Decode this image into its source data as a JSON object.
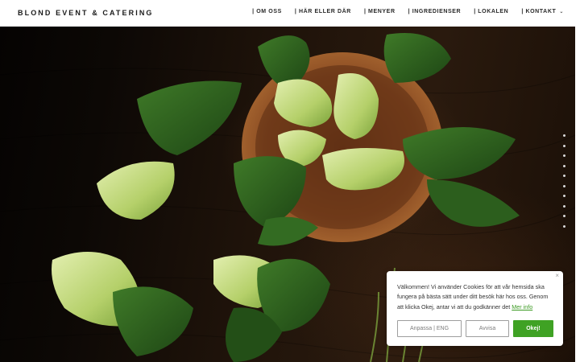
{
  "header": {
    "brand": "BLOND EVENT & CATERING",
    "nav": [
      {
        "label": "| OM OSS"
      },
      {
        "label": "| HÄR ELLER DÄR"
      },
      {
        "label": "| MENYER"
      },
      {
        "label": "| INGREDIENSER"
      },
      {
        "label": "| LOKALEN"
      },
      {
        "label": "| KONTAKT",
        "has_dropdown": true
      }
    ]
  },
  "hero": {
    "image": "bok-choy-on-dark-wood",
    "slide_count": 10
  },
  "cookie_banner": {
    "text": "Välkommen! Vi använder Cookies för att vår hemsida ska fungera på bästa sätt under ditt besök här hos oss. Genom att klicka Okej, antar vi att du godkänner det",
    "link": "Mer info",
    "buttons": {
      "customize": "Anpassa | ENG",
      "reject": "Avvisa",
      "accept": "Okej!"
    },
    "close_icon": "×"
  },
  "colors": {
    "accent_green": "#3fa224",
    "link_green": "#3b9a22"
  }
}
